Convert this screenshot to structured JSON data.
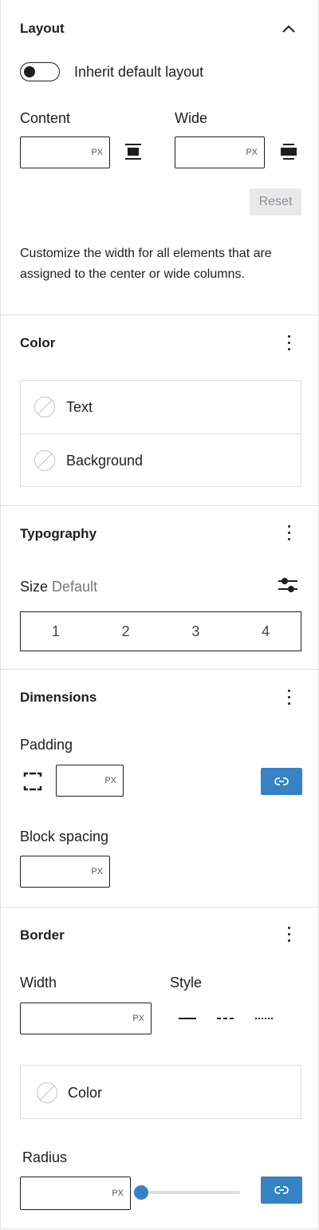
{
  "layout": {
    "title": "Layout",
    "toggle_label": "Inherit default layout",
    "content_label": "Content",
    "wide_label": "Wide",
    "unit": "PX",
    "reset_label": "Reset",
    "help": "Customize the width for all elements that are assigned to the center or wide columns."
  },
  "color": {
    "title": "Color",
    "items": [
      "Text",
      "Background"
    ]
  },
  "typography": {
    "title": "Typography",
    "size_label": "Size",
    "size_value": "Default",
    "sizes": [
      "1",
      "2",
      "3",
      "4"
    ]
  },
  "dimensions": {
    "title": "Dimensions",
    "padding_label": "Padding",
    "block_spacing_label": "Block spacing",
    "unit": "PX"
  },
  "border": {
    "title": "Border",
    "width_label": "Width",
    "style_label": "Style",
    "color_label": "Color",
    "radius_label": "Radius",
    "unit": "PX",
    "radius_value": 0
  },
  "colors": {
    "accent": "#3582c4",
    "border": "#e0e0e0",
    "reset_bg": "#e9e9ea"
  }
}
